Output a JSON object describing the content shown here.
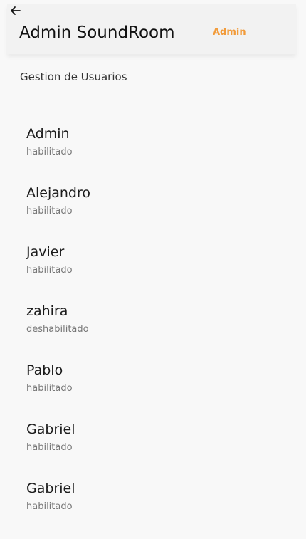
{
  "header": {
    "back_icon": "arrow-left-icon",
    "title": "Admin SoundRoom",
    "role_badge": "Admin",
    "accent_color": "#f29b3a"
  },
  "section": {
    "title": "Gestion de Usuarios"
  },
  "users": [
    {
      "name": "Admin",
      "status": "habilitado"
    },
    {
      "name": "Alejandro",
      "status": "habilitado"
    },
    {
      "name": "Javier",
      "status": "habilitado"
    },
    {
      "name": "zahira",
      "status": "deshabilitado"
    },
    {
      "name": "Pablo",
      "status": "habilitado"
    },
    {
      "name": "Gabriel",
      "status": "habilitado"
    },
    {
      "name": "Gabriel",
      "status": "habilitado"
    }
  ]
}
